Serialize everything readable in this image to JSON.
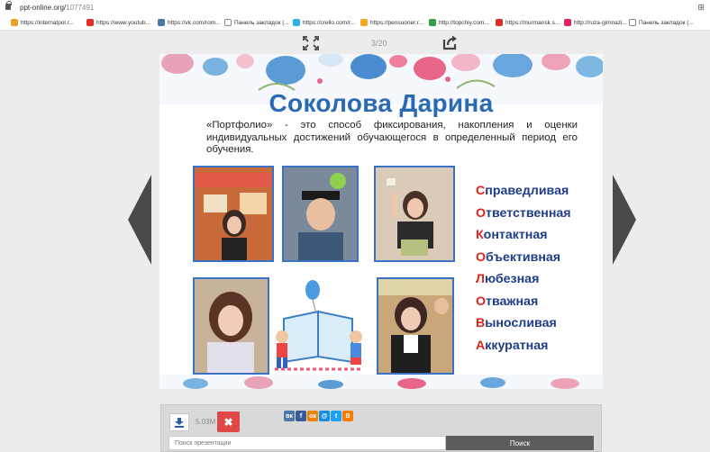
{
  "browser": {
    "url_host": "ppt-online.org/",
    "url_path": "1077491",
    "bookmarks": [
      {
        "label": "https://internatpol.r...",
        "color": "#f0a020"
      },
      {
        "label": "https://www.youtub...",
        "color": "#e52d27"
      },
      {
        "label": "https://vk.com/rom...",
        "color": "#4a76a8"
      },
      {
        "label": "Панель закладок (...",
        "color": "#888888"
      },
      {
        "label": "https://crello.com/r...",
        "color": "#2bb0e8"
      },
      {
        "label": "https://pensuoner.r...",
        "color": "#f5a623"
      },
      {
        "label": "http://topchiy.com...",
        "color": "#2e9e4a"
      },
      {
        "label": "https://murmansk.s...",
        "color": "#d93025"
      },
      {
        "label": "http://ruza-gimnazi...",
        "color": "#e0245e"
      },
      {
        "label": "Панель закладок (...",
        "color": "#888888"
      }
    ]
  },
  "viewer": {
    "counter": "3/20",
    "icons": {
      "fullscreen": "fullscreen-icon",
      "share": "share-icon",
      "prev": "arrow-left-icon",
      "next": "arrow-right-icon"
    }
  },
  "slide": {
    "title": "Соколова Дарина",
    "description": "«Портфолио» - это способ фиксирования, накопления и оценки индивидуальных достижений обучающегося в определенный период его обучения.",
    "traits": [
      {
        "first": "С",
        "rest": "праведливая"
      },
      {
        "first": "О",
        "rest": "тветственная"
      },
      {
        "first": "К",
        "rest": "онтактная"
      },
      {
        "first": "О",
        "rest": "бъективная"
      },
      {
        "first": "Л",
        "rest": "юбезная"
      },
      {
        "first": "О",
        "rest": "тважная"
      },
      {
        "first": "В",
        "rest": "ыносливая"
      },
      {
        "first": "А",
        "rest": "ккуратная"
      }
    ],
    "accent_color": "#2a6ab5",
    "highlight_color": "#e0241c"
  },
  "toolbar": {
    "file_size": "5.03M",
    "socials": [
      {
        "name": "vk",
        "label": "вк",
        "color": "#4a76a8"
      },
      {
        "name": "facebook",
        "label": "f",
        "color": "#3b5998"
      },
      {
        "name": "odnoklassniki",
        "label": "ок",
        "color": "#ee8208"
      },
      {
        "name": "moimir",
        "label": "@",
        "color": "#168de2"
      },
      {
        "name": "twitter",
        "label": "t",
        "color": "#1da1f2"
      },
      {
        "name": "blogger",
        "label": "B",
        "color": "#f57d00"
      }
    ],
    "search_placeholder": "Поиск презентации",
    "search_button": "Поиск"
  }
}
